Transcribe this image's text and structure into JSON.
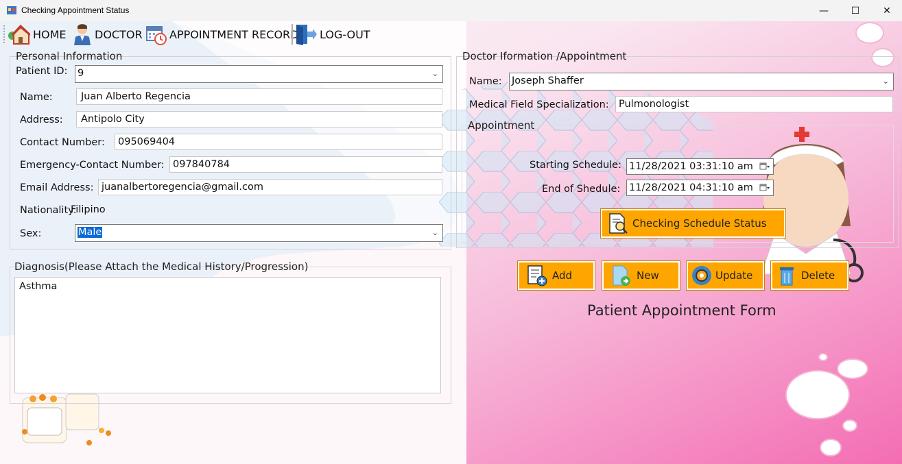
{
  "window": {
    "title": "Checking Appointment Status",
    "controls": {
      "minimize": "—",
      "maximize": "☐",
      "close": "✕"
    }
  },
  "menu": {
    "home": "HOME",
    "doctor": "DOCTOR",
    "appointment_record": "APPOINTMENT RECORD",
    "logout": "LOG-OUT"
  },
  "personal": {
    "legend": "Personal Information",
    "patient_id_label": "Patient ID:",
    "patient_id": "9",
    "name_label": "Name:",
    "name": "Juan Alberto Regencia",
    "address_label": "Address:",
    "address": "Antipolo City",
    "contact_label": "Contact Number:",
    "contact": "095069404",
    "emergency_label": "Emergency-Contact Number:",
    "emergency": "097840784",
    "email_label": "Email Address:",
    "email": "juanalbertoregencia@gmail.com",
    "nationality_label": "Nationality:",
    "nationality": "Filipino",
    "sex_label": "Sex:",
    "sex": "Male"
  },
  "diagnosis": {
    "legend": "Diagnosis(Please Attach the Medical History/Progression)",
    "text": "Asthma"
  },
  "doctor": {
    "legend": "Doctor Iformation /Appointment",
    "name_label": "Name:",
    "name": "Joseph Shaffer",
    "specialization_label": "Medical Field Specialization:",
    "specialization": "Pulmonologist",
    "appointment_label": "Appointment",
    "start_label": "Starting Schedule:",
    "start": "11/28/2021 03:31:10 am",
    "end_label": "End of Shedule:",
    "end": "11/28/2021 04:31:10 am"
  },
  "buttons": {
    "check": "Checking Schedule Status",
    "add": "Add",
    "new": "New",
    "update": "Update",
    "delete": "Delete"
  },
  "form_title": "Patient Appointment Form",
  "colors": {
    "button": "#ffa500",
    "selection": "#0a6ad6",
    "accent_pink": "#f46db4"
  }
}
